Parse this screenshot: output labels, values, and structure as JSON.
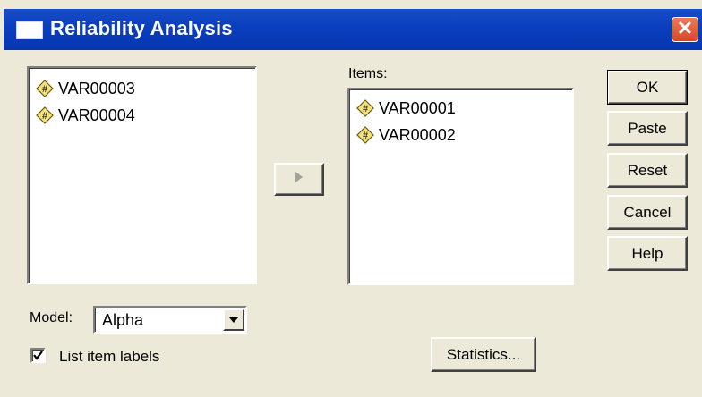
{
  "window": {
    "title": "Reliability Analysis",
    "close_glyph": "✕"
  },
  "source_list": {
    "items": [
      {
        "label": "VAR00003",
        "icon": "numeric-variable-icon"
      },
      {
        "label": "VAR00004",
        "icon": "numeric-variable-icon"
      }
    ]
  },
  "items_list": {
    "label": "Items:",
    "items": [
      {
        "label": "VAR00001",
        "icon": "numeric-variable-icon"
      },
      {
        "label": "VAR00002",
        "icon": "numeric-variable-icon"
      }
    ]
  },
  "buttons": {
    "ok": "OK",
    "paste": "Paste",
    "reset": "Reset",
    "cancel": "Cancel",
    "help": "Help",
    "statistics": "Statistics..."
  },
  "model": {
    "label": "Model:",
    "selected": "Alpha"
  },
  "list_item_labels": {
    "label": "List item labels",
    "checked": true
  },
  "colors": {
    "titlebar": "#0a3fbf",
    "dialog_bg": "#ece9d8",
    "variable_icon_fill": "#f5e27a"
  }
}
